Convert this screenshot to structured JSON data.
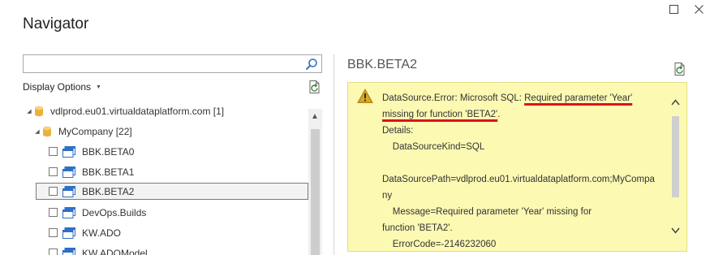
{
  "window": {
    "title": "Navigator",
    "maximize_icon": "maximize-icon",
    "close_icon": "close-icon"
  },
  "left_pane": {
    "search": {
      "value": "",
      "placeholder": "",
      "icon": "search-icon"
    },
    "display_options_label": "Display Options",
    "refresh_icon": "refresh-icon",
    "tree": {
      "server": {
        "label": "vdlprod.eu01.virtualdataplatform.com [1]",
        "expanded": true,
        "icon": "database-icon"
      },
      "database": {
        "label": "MyCompany [22]",
        "expanded": true,
        "icon": "database-icon"
      },
      "items": [
        {
          "label": "BBK.BETA0",
          "checked": false,
          "selected": false,
          "icon": "table-icon"
        },
        {
          "label": "BBK.BETA1",
          "checked": false,
          "selected": false,
          "icon": "table-icon"
        },
        {
          "label": "BBK.BETA2",
          "checked": false,
          "selected": true,
          "icon": "table-icon"
        },
        {
          "label": "DevOps.Builds",
          "checked": false,
          "selected": false,
          "icon": "table-icon"
        },
        {
          "label": "KW.ADO",
          "checked": false,
          "selected": false,
          "icon": "table-icon"
        },
        {
          "label": "KW.ADOModel",
          "checked": false,
          "selected": false,
          "icon": "table-icon"
        }
      ]
    }
  },
  "right_pane": {
    "title": "BBK.BETA2",
    "refresh_icon": "refresh-icon",
    "error": {
      "icon": "warning-icon",
      "line1_prefix": "DataSource.Error: Microsoft SQL: ",
      "line1_highlight": "Required parameter 'Year'",
      "line2_highlight": "missing for function 'BETA2'",
      "line2_suffix": ".",
      "details_label": "Details:",
      "datasource_kind": "    DataSourceKind=SQL",
      "blank": " ",
      "datasource_path_1": "DataSourcePath=vdlprod.eu01.virtualdataplatform.com;MyCompa",
      "datasource_path_2": "ny",
      "message_1": "    Message=Required parameter 'Year' missing for",
      "message_2": "function 'BETA2'.",
      "error_code": "    ErrorCode=-2146232060"
    },
    "colors": {
      "panel_bg": "#fcf9b3",
      "underline": "#d9141a"
    }
  }
}
